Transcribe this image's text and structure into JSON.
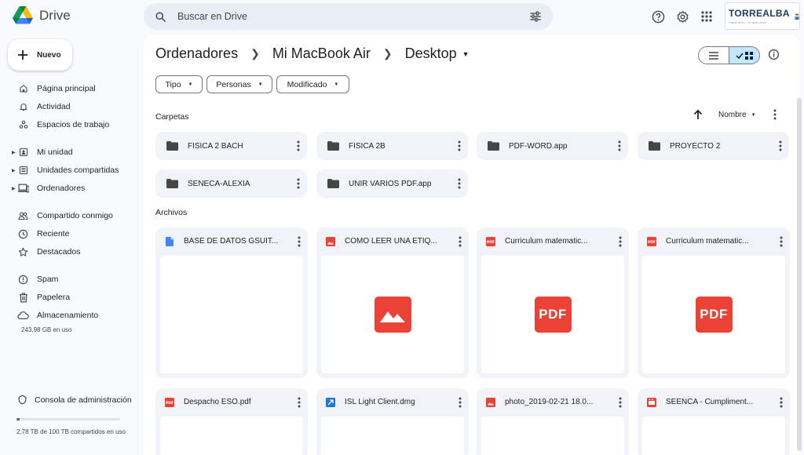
{
  "app": {
    "name": "Drive"
  },
  "search": {
    "placeholder": "Buscar en Drive"
  },
  "profile": {
    "name": "TORREALBA",
    "subtitle": "Carpe diem - ne quid nimis"
  },
  "sidebar": {
    "new_label": "Nuevo",
    "items": [
      {
        "label": "Página principal",
        "icon": "home-icon"
      },
      {
        "label": "Actividad",
        "icon": "bell-icon"
      },
      {
        "label": "Espacios de trabajo",
        "icon": "workspaces-icon"
      },
      {
        "label": "Mi unidad",
        "icon": "my-drive-icon"
      },
      {
        "label": "Unidades compartidas",
        "icon": "shared-drives-icon"
      },
      {
        "label": "Ordenadores",
        "icon": "computer-icon"
      },
      {
        "label": "Compartido conmigo",
        "icon": "people-icon"
      },
      {
        "label": "Reciente",
        "icon": "clock-icon"
      },
      {
        "label": "Destacados",
        "icon": "star-icon"
      },
      {
        "label": "Spam",
        "icon": "spam-icon"
      },
      {
        "label": "Papelera",
        "icon": "trash-icon"
      },
      {
        "label": "Almacenamiento",
        "icon": "cloud-icon"
      }
    ],
    "storage_used": "243,98 GB en uso",
    "admin_label": "Consola de administración",
    "storage_bottom": "2,78 TB de 100 TB compartidos en uso",
    "storage_fraction": 0.03
  },
  "breadcrumb": {
    "items": [
      "Ordenadores",
      "Mi MacBook Air",
      "Desktop"
    ]
  },
  "filters": {
    "type": "Tipo",
    "people": "Personas",
    "modified": "Modificado"
  },
  "sections": {
    "folders": "Carpetas",
    "files": "Archivos"
  },
  "sort": {
    "label": "Nombre"
  },
  "folders": [
    {
      "name": "FISICA 2 BACH"
    },
    {
      "name": "FISICA 2B"
    },
    {
      "name": "PDF-WORD.app"
    },
    {
      "name": "PROYECTO 2"
    },
    {
      "name": "SENECA-ALEXIA"
    },
    {
      "name": "UNIR VARIOS PDF.app"
    }
  ],
  "files": [
    {
      "name": "BASE DE DATOS GSUIT...",
      "type": "doc"
    },
    {
      "name": "COMO LEER UNA ETIQ...",
      "type": "image"
    },
    {
      "name": "Curriculum matematic...",
      "type": "pdf"
    },
    {
      "name": "Curriculum matematic...",
      "type": "pdf"
    },
    {
      "name": "Despacho ESO.pdf",
      "type": "pdf"
    },
    {
      "name": "ISL Light Client.dmg",
      "type": "app"
    },
    {
      "name": "photo_2019-02-21 18.0...",
      "type": "image"
    },
    {
      "name": "SEENCA - Cumpliment...",
      "type": "video"
    }
  ],
  "thumb_labels": {
    "pdf": "PDF"
  },
  "colors": {
    "accent": "#c2e7ff",
    "pdf_red": "#ea4335",
    "doc_blue": "#4285f4",
    "surface": "#f0f4f9"
  }
}
